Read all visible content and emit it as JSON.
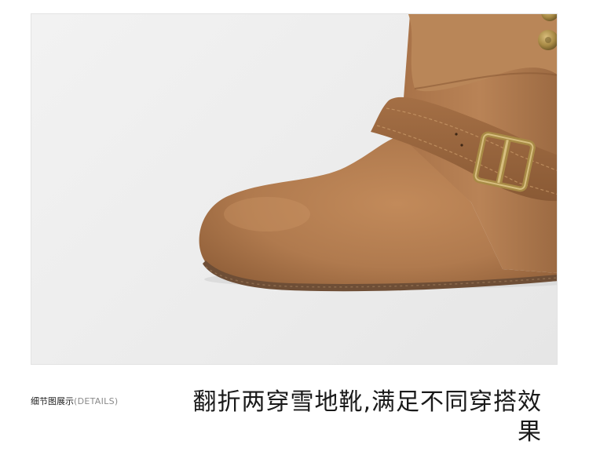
{
  "product_photo": {
    "subject": "boot-image",
    "colors": {
      "background": "#efefef",
      "suede": "#b07a4e",
      "suede_dark": "#8f5e38",
      "buckle": "#a88a45",
      "sole": "#6e4e36"
    }
  },
  "section": {
    "label_cn": "细节图展示",
    "label_en": "(DETAILS)"
  },
  "headline": "翻折两穿雪地靴,满足不同穿搭效果"
}
